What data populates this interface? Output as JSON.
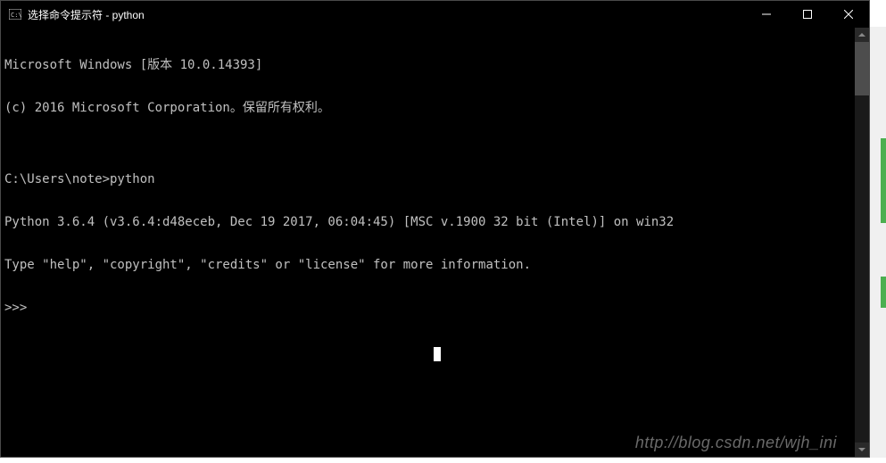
{
  "titlebar": {
    "title": "选择命令提示符 - python"
  },
  "terminal": {
    "lines": [
      "Microsoft Windows [版本 10.0.14393]",
      "(c) 2016 Microsoft Corporation。保留所有权利。",
      "",
      "C:\\Users\\note>python",
      "Python 3.6.4 (v3.6.4:d48eceb, Dec 19 2017, 06:04:45) [MSC v.1900 32 bit (Intel)] on win32",
      "Type \"help\", \"copyright\", \"credits\" or \"license\" for more information.",
      ">>>"
    ]
  },
  "watermark": "http://blog.csdn.net/wjh_ini"
}
